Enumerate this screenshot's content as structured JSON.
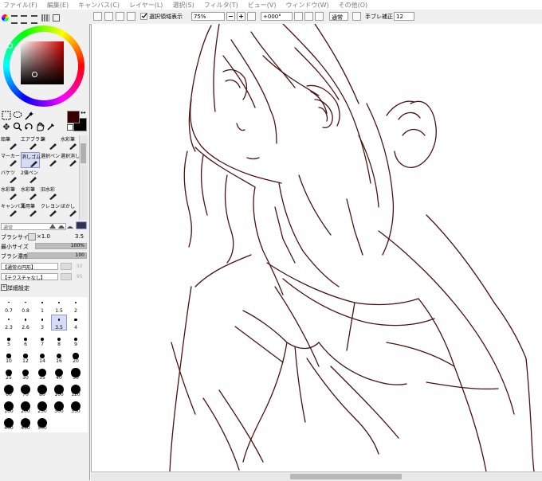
{
  "menu": [
    "ファイル(F)",
    "編集(E)",
    "キャンバス(C)",
    "レイヤー(L)",
    "選択(S)",
    "フィルタ(T)",
    "ビュー(V)",
    "ウィンドウ(W)",
    "その他(O)"
  ],
  "toolbar": {
    "selection_label": "選択領域表示",
    "zoom": "75%",
    "rotation": "+000°",
    "blend": "通常",
    "stabilizer_label": "手ブレ補正",
    "stabilizer_value": "12"
  },
  "colors": {
    "primary": "#3a0000",
    "secondary": "#000000",
    "accent_select": "#d6dcf5",
    "line": "#4a1212"
  },
  "brushes": [
    {
      "label": "鉛筆",
      "col": 0,
      "row": 0
    },
    {
      "label": "エアブラシ",
      "col": 1,
      "row": 0
    },
    {
      "label": "筆",
      "col": 2,
      "row": 0
    },
    {
      "label": "水彩筆",
      "col": 3,
      "row": 0
    },
    {
      "label": "マーカー",
      "col": 0,
      "row": 1
    },
    {
      "label": "消しゴム",
      "col": 1,
      "row": 1
    },
    {
      "label": "選択ペン",
      "col": 2,
      "row": 1
    },
    {
      "label": "選択消し",
      "col": 3,
      "row": 1
    },
    {
      "label": "バケツ",
      "col": 0,
      "row": 2
    },
    {
      "label": "2値ペン",
      "col": 1,
      "row": 2
    },
    {
      "label": "水彩筆",
      "col": 0,
      "row": 3
    },
    {
      "label": "水彩筆",
      "col": 1,
      "row": 3
    },
    {
      "label": "旧水彩",
      "col": 2,
      "row": 3
    },
    {
      "label": "キャンバス",
      "col": 0,
      "row": 4
    },
    {
      "label": "薄用筆",
      "col": 1,
      "row": 4
    },
    {
      "label": "クレヨン",
      "col": 2,
      "row": 4
    },
    {
      "label": "ぼかし",
      "col": 3,
      "row": 4
    }
  ],
  "brush_settings": {
    "mode": "通常",
    "size_label": "ブラシサイズ",
    "size_mult": "×1.0",
    "size_value": "3.5",
    "min_size_label": "最小サイズ",
    "min_size_value": "100%",
    "density_label": "ブラシ濃度",
    "density_value": "100",
    "shape": "【通常の円形】",
    "texture": "【テクスチャなし】",
    "detail_label": "詳細設定",
    "fx_a": "50",
    "fx_b": "95"
  },
  "brush_sizes": [
    "0.7",
    "0.8",
    "1",
    "1.5",
    "2",
    "2.3",
    "2.6",
    "3",
    "3.5",
    "4",
    "5",
    "6",
    "7",
    "8",
    "9",
    "10",
    "12",
    "14",
    "16",
    "20",
    "25",
    "30",
    "35",
    "40",
    "50",
    "60",
    "70",
    "80",
    "100",
    "120",
    "160",
    "200",
    "250",
    "300",
    "350",
    "400",
    "450",
    "500"
  ],
  "selected_size": "3.5"
}
